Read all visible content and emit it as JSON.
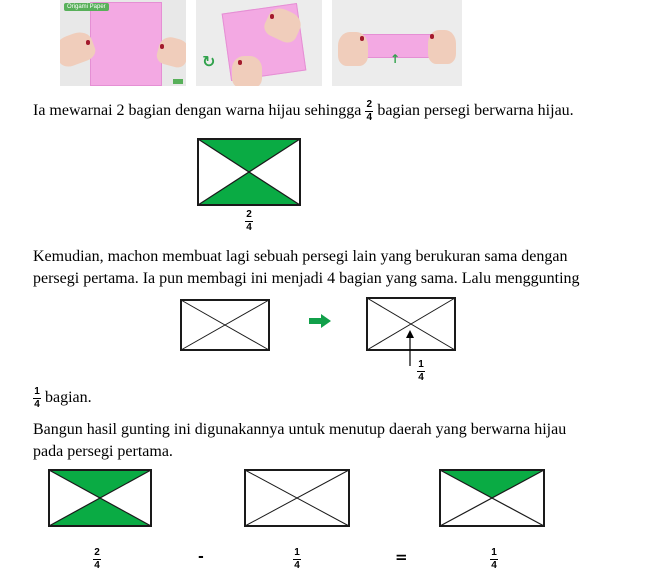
{
  "photos": {
    "logo_text": "Origami Paper",
    "rotate_icon": "rotate-arrow-icon",
    "up_icon": "up-arrow-icon"
  },
  "paragraph1": {
    "before": "Ia mewarnai 2 bagian dengan warna hijau sehingga",
    "frac_num": "2",
    "frac_den": "4",
    "after": "bagian persegi berwarna hijau."
  },
  "figure1": {
    "label_num": "2",
    "label_den": "4"
  },
  "paragraph2": {
    "line1": "Kemudian, machon membuat lagi sebuah persegi lain yang berukuran sama dengan",
    "line2": "persegi pertama. Ia pun membagi ini menjadi 4 bagian yang sama. Lalu menggunting"
  },
  "figure2": {
    "arrow_icon": "right-arrow-icon",
    "label_num": "1",
    "label_den": "4"
  },
  "paragraph3": {
    "frac_num": "1",
    "frac_den": "4",
    "after": "bagian.",
    "line2": "Bangun hasil gunting ini digunakannya untuk menutup daerah yang berwarna hijau",
    "line3": "pada persegi pertama."
  },
  "equation": {
    "term1_num": "2",
    "term1_den": "4",
    "operator": "-",
    "term2_num": "1",
    "term2_den": "4",
    "equals": "=",
    "result_num": "1",
    "result_den": "4"
  },
  "colors": {
    "green": "#0aab44",
    "pink": "#f3a9e3",
    "arrow_green": "#11a04a"
  }
}
